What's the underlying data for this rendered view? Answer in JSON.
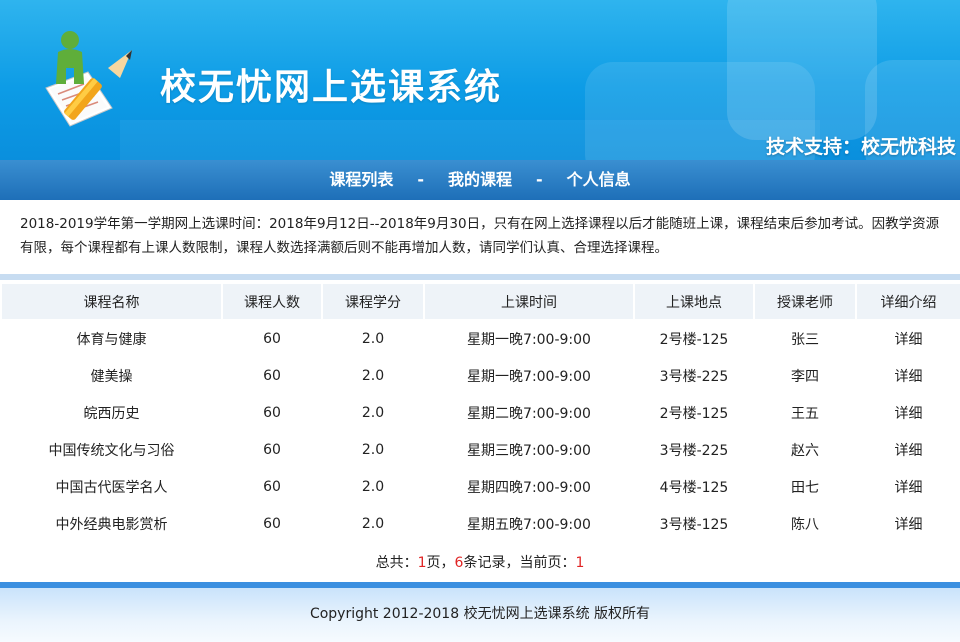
{
  "header": {
    "site_title": "校无忧网上选课系统",
    "tech_support": "技术支持：校无忧科技",
    "logo_icon": "student-pencil-logo-icon"
  },
  "nav": {
    "items": [
      {
        "label": "课程列表"
      },
      {
        "label": "我的课程"
      },
      {
        "label": "个人信息"
      }
    ],
    "separator": "-"
  },
  "notice": {
    "text": "2018-2019学年第一学期网上选课时间：2018年9月12日--2018年9月30日，只有在网上选择课程以后才能随班上课，课程结束后参加考试。因教学资源有限，每个课程都有上课人数限制，课程人数选择满额后则不能再增加人数，请同学们认真、合理选择课程。"
  },
  "table": {
    "headers": [
      "课程名称",
      "课程人数",
      "课程学分",
      "上课时间",
      "上课地点",
      "授课老师",
      "详细介绍"
    ],
    "rows": [
      [
        "体育与健康",
        "60",
        "2.0",
        "星期一晚7:00-9:00",
        "2号楼-125",
        "张三",
        "详细"
      ],
      [
        "健美操",
        "60",
        "2.0",
        "星期一晚7:00-9:00",
        "3号楼-225",
        "李四",
        "详细"
      ],
      [
        "皖西历史",
        "60",
        "2.0",
        "星期二晚7:00-9:00",
        "2号楼-125",
        "王五",
        "详细"
      ],
      [
        "中国传统文化与习俗",
        "60",
        "2.0",
        "星期三晚7:00-9:00",
        "3号楼-225",
        "赵六",
        "详细"
      ],
      [
        "中国古代医学名人",
        "60",
        "2.0",
        "星期四晚7:00-9:00",
        "4号楼-125",
        "田七",
        "详细"
      ],
      [
        "中外经典电影赏析",
        "60",
        "2.0",
        "星期五晚7:00-9:00",
        "3号楼-125",
        "陈八",
        "详细"
      ]
    ]
  },
  "pager": {
    "prefix": "总共：",
    "total_pages": "1",
    "pages_suffix": "页，",
    "total_records": "6",
    "records_suffix": "条记录，当前页：",
    "current_page": "1"
  },
  "footer": {
    "copyright": "Copyright 2012-2018 校无忧网上选课系统 版权所有"
  },
  "colors": {
    "header_blue": "#0d9ce6",
    "nav_blue": "#1e6fb8",
    "accent_red": "#e02424"
  }
}
